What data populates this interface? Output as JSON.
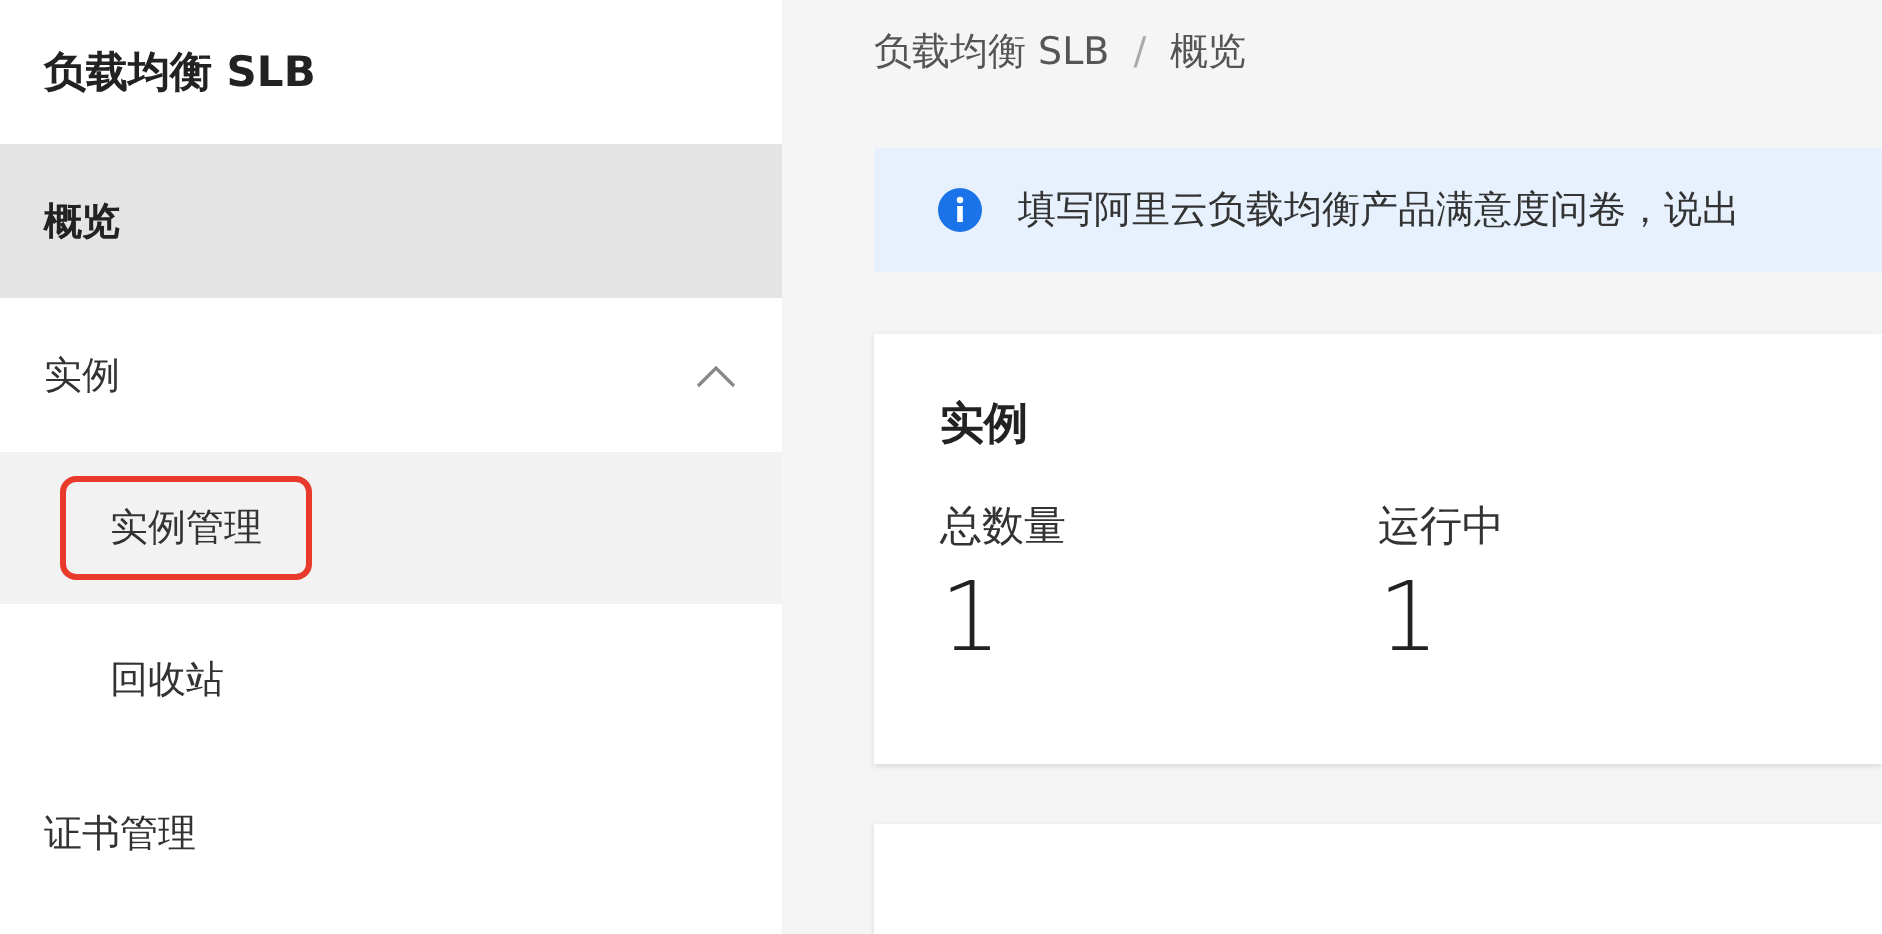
{
  "sidebar": {
    "title": "负载均衡 SLB",
    "items": [
      {
        "label": "概览",
        "selected": true,
        "kind": "link"
      },
      {
        "label": "实例",
        "selected": false,
        "kind": "group",
        "expanded": true,
        "children": [
          {
            "label": "实例管理",
            "selected": false,
            "hovered": true,
            "highlighted": true
          },
          {
            "label": "回收站",
            "selected": false,
            "hovered": false,
            "highlighted": false
          }
        ]
      },
      {
        "label": "证书管理",
        "selected": false,
        "kind": "link"
      }
    ]
  },
  "breadcrumb": {
    "separator": "/",
    "items": [
      "负载均衡 SLB",
      "概览"
    ]
  },
  "banner": {
    "text": "填写阿里云负载均衡产品满意度问卷，说出"
  },
  "card": {
    "title": "实例",
    "stats": [
      {
        "label": "总数量",
        "value": "1"
      },
      {
        "label": "运行中",
        "value": "1"
      }
    ]
  }
}
